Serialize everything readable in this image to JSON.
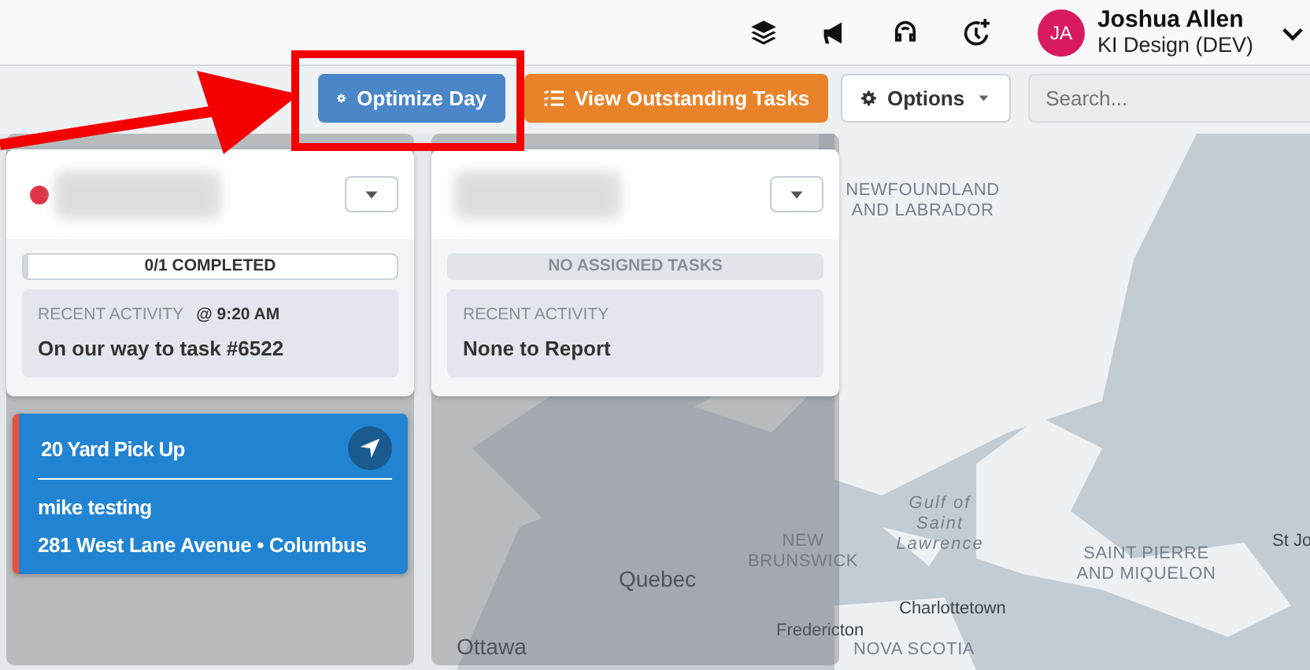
{
  "header": {
    "icons": [
      {
        "kind": "layers"
      },
      {
        "kind": "megaphone"
      },
      {
        "kind": "headset"
      },
      {
        "kind": "clock-plus"
      }
    ],
    "user": {
      "initials": "JA",
      "name": "Joshua Allen",
      "org": "KI Design (DEV)"
    }
  },
  "toolbar": {
    "buttons": [
      {
        "kind": "primary",
        "label": "Optimize Day",
        "highlighted": true
      },
      {
        "kind": "warning",
        "label": "View Outstanding Tasks"
      },
      {
        "kind": "dropdown",
        "label": "Options"
      }
    ],
    "search": {
      "placeholder": "Search..."
    }
  },
  "columns": [
    {
      "color": "#dc3545",
      "menu_expanded": false,
      "progress": {
        "kind": "progress",
        "label": "0/1 COMPLETED",
        "level": 0
      },
      "recent_activity": {
        "label": "RECENT ACTIVITY",
        "time": "@ 9:20 AM",
        "text": "On our way to task #6522"
      },
      "tasks": [
        {
          "title": "20 Yard Pick Up",
          "customer": "mike testing",
          "address": "281 West Lane Avenue • Columbus"
        }
      ]
    },
    {
      "menu_expanded": false,
      "progress": {
        "kind": "empty",
        "label": "NO ASSIGNED TASKS"
      },
      "recent_activity": {
        "label": "RECENT ACTIVITY",
        "text": "None to Report"
      }
    }
  ],
  "map": {
    "labels": [
      {
        "text": "NEWFOUNDLAND AND LABRADOR",
        "kind": "region"
      },
      {
        "text": "Gulf of Saint Lawrence",
        "kind": "water"
      },
      {
        "text": "SAINT PIERRE AND MIQUELON",
        "kind": "region"
      },
      {
        "text": "St Jo",
        "kind": "city"
      },
      {
        "text": "Charlottetown",
        "kind": "city"
      },
      {
        "text": "NOVA SCOTIA",
        "kind": "region"
      },
      {
        "text": "Quebec",
        "kind": "city"
      },
      {
        "text": "NEW BRUNSWICK",
        "kind": "region"
      },
      {
        "text": "Fredericton",
        "kind": "city"
      },
      {
        "text": "Ottawa",
        "kind": "city"
      }
    ]
  }
}
